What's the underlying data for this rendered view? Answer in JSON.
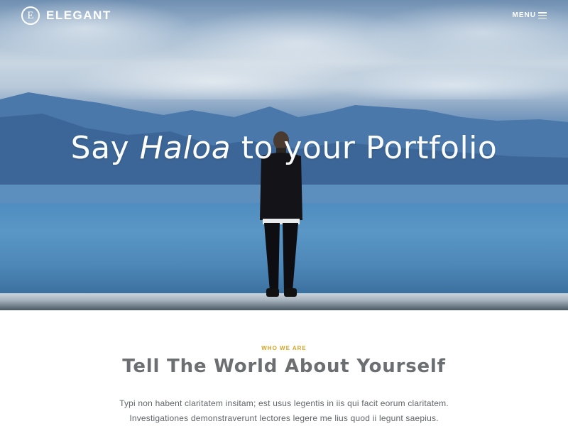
{
  "header": {
    "logo_mark": "E",
    "logo_text": "ELEGANT",
    "menu_label": "MENU"
  },
  "hero": {
    "headline_pre": "Say ",
    "headline_italic": "Haloa",
    "headline_post": " to your Portfolio"
  },
  "about": {
    "eyebrow": "WHO WE ARE",
    "title": "Tell The World About Yourself",
    "lines": [
      "Typi non habent claritatem insitam; est usus legentis in iis qui facit eorum claritatem.",
      "Investigationes demonstraverunt lectores legere me lius quod ii legunt saepius."
    ]
  },
  "colors": {
    "accent": "#d7a21f",
    "title": "#6b6f72",
    "body_text": "#5f6468"
  },
  "icons": [
    "logo-e-icon",
    "hamburger-menu-icon"
  ]
}
